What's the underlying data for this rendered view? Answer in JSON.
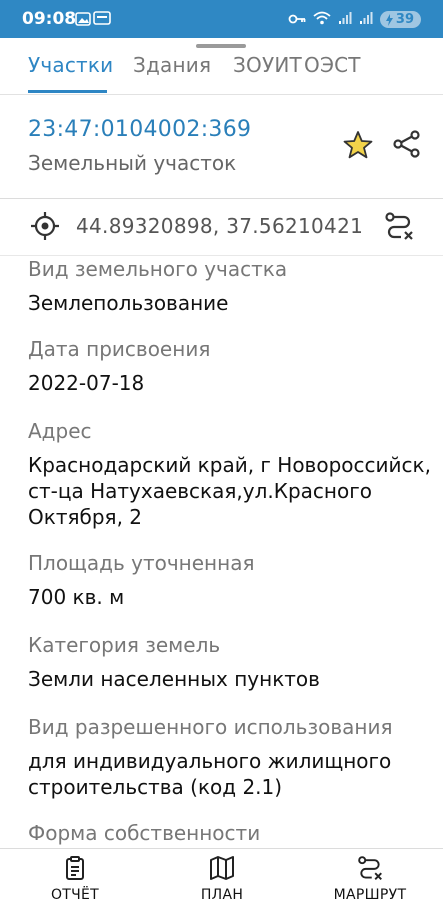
{
  "status_bar": {
    "time": "09:08",
    "battery": "39"
  },
  "tabs": [
    {
      "label": "Участки",
      "active": true
    },
    {
      "label": "Здания",
      "active": false
    },
    {
      "label": "ЗОУИТ",
      "active": false
    },
    {
      "label": "ОЭСТ",
      "active": false
    }
  ],
  "header": {
    "cadastral_number": "23:47:0104002:369",
    "object_type": "Земельный участок"
  },
  "coordinates": {
    "text": "44.89320898, 37.56210421"
  },
  "fields": [
    {
      "label": "Вид земельного участка",
      "value": "Землепользование"
    },
    {
      "label": "Дата присвоения",
      "value": "2022-07-18"
    },
    {
      "label": "Адрес",
      "value": "Краснодарский край, г Новороссийск, ст-ца Натухаевская,ул.Красного Октября, 2"
    },
    {
      "label": "Площадь уточненная",
      "value": "700 кв. м"
    },
    {
      "label": "Категория земель",
      "value": "Земли населенных пунктов"
    },
    {
      "label": "Вид разрешенного использования",
      "value": "для индивидуального жилищного строительства (код 2.1)"
    },
    {
      "label": "Форма собственности",
      "value": ""
    }
  ],
  "bottom_nav": {
    "report": "ОТЧЁТ",
    "plan": "ПЛАН",
    "route": "МАРШРУТ"
  },
  "colors": {
    "accent": "#2e86c4",
    "status_bar": "#2f88c4",
    "star": "#e0b400"
  }
}
